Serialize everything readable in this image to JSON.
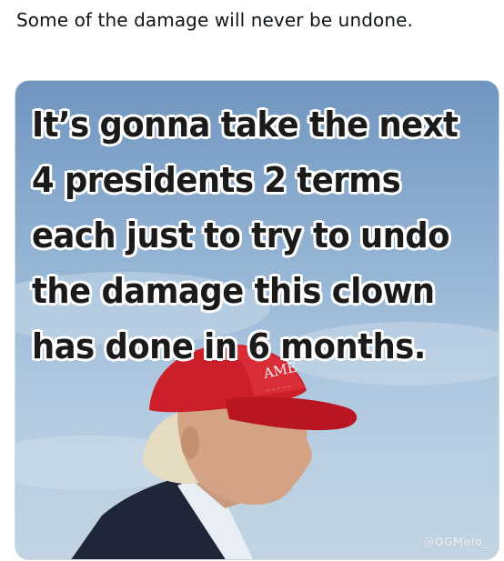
{
  "post": {
    "text": "Some of the damage will never be undone."
  },
  "media": {
    "overlay_lines": [
      "It’s gonna take the next",
      "4 presidents 2 terms",
      "each just to try to undo",
      "the damage this clown",
      "has done in 6 months."
    ],
    "hat_text": "AME",
    "watermark": "@OGMelo_"
  }
}
